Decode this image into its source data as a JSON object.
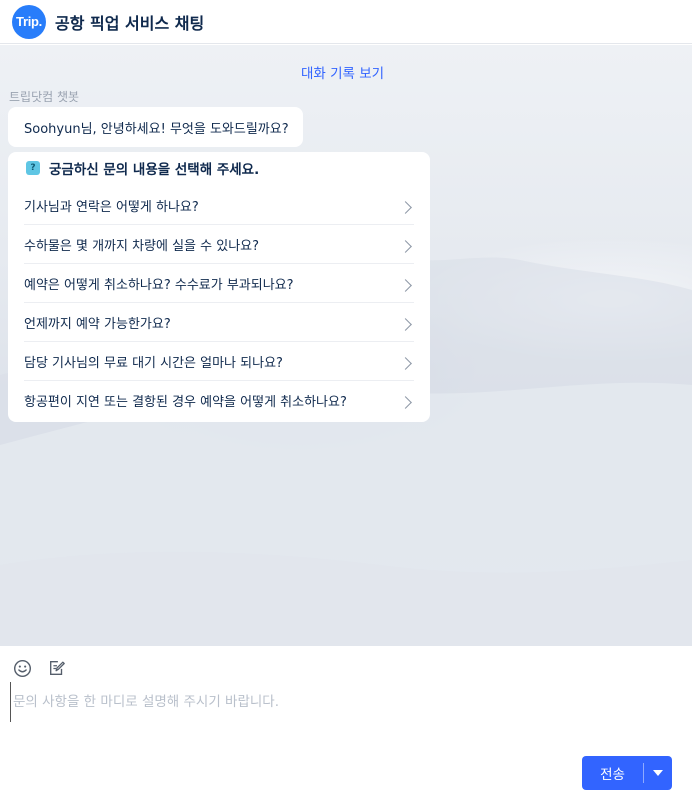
{
  "header": {
    "logo_text": "Trip.",
    "title": "공항 픽업 서비스 채팅"
  },
  "chat": {
    "history_link": "대화 기록 보기",
    "bot_name": "트립닷컴 챗봇",
    "greeting": "Soohyun님, 안녕하세요! 무엇을 도와드릴까요?",
    "faq": {
      "icon_glyph": "?",
      "title": "궁금하신 문의 내용을 선택해 주세요.",
      "items": [
        "기사님과 연락은 어떻게 하나요?",
        "수하물은 몇 개까지 차량에 실을 수 있나요?",
        "예약은 어떻게 취소하나요? 수수료가 부과되나요?",
        "언제까지 예약 가능한가요?",
        "담당 기사님의 무료 대기 시간은 얼마나 되나요?",
        "항공편이 지연 또는 결항된 경우 예약을 어떻게 취소하나요?"
      ]
    }
  },
  "composer": {
    "placeholder": "문의 사항을 한 마디로 설명해 주시기 바랍니다.",
    "value": "",
    "send_label": "전송"
  },
  "colors": {
    "accent": "#3264ff",
    "brand": "#287dfa",
    "text": "#0f294d",
    "muted": "#9aa3b1"
  },
  "icons": {
    "logo": "trip-logo-icon",
    "emoji": "smiley-icon",
    "form": "edit-form-icon",
    "faq": "question-icon",
    "chevron": "chevron-right-icon",
    "dropdown": "caret-down-icon"
  }
}
